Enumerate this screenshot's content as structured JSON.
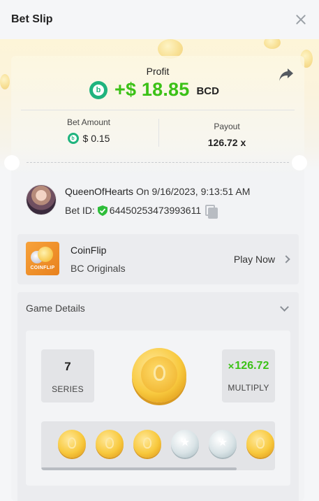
{
  "header": {
    "title": "Bet Slip",
    "close_icon": "close-icon"
  },
  "profit": {
    "label": "Profit",
    "amount": "+$ 18.85",
    "currency": "BCD",
    "icon": "bc-coin-icon",
    "accent": "#3bc117"
  },
  "bet_amount": {
    "label": "Bet Amount",
    "value": "$ 0.15"
  },
  "payout": {
    "label": "Payout",
    "value": "126.72 x"
  },
  "user": {
    "name": "QueenOfHearts",
    "datetime": "On 9/16/2023, 9:13:51 AM",
    "bet_id_label": "Bet ID:",
    "bet_id": "64450253473993611"
  },
  "game": {
    "thumb_text": "COINFLIP",
    "name": "CoinFlip",
    "provider": "BC Originals",
    "play_label": "Play Now"
  },
  "details": {
    "title": "Game Details",
    "series_value": "7",
    "series_label": "SERIES",
    "multiply_value": "126.72",
    "multiply_prefix": "×",
    "multiply_label": "MULTIPLY",
    "history": [
      "gold",
      "gold",
      "gold",
      "silver",
      "silver",
      "gold"
    ]
  }
}
